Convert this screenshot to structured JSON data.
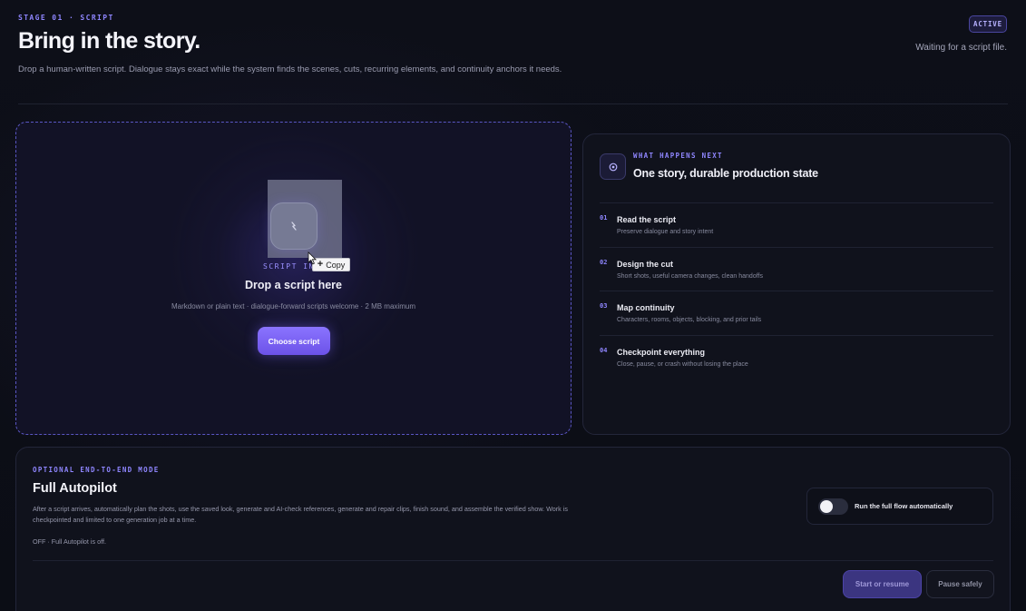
{
  "header": {
    "eyebrow": "STAGE 01 · SCRIPT",
    "title": "Bring in the story.",
    "subtitle": "Drop a human-written script. Dialogue stays exact while the system finds the scenes, cuts, recurring elements, and continuity anchors it needs.",
    "badge": "ACTIVE",
    "status": "Waiting for a script file."
  },
  "dropzone": {
    "intake_label": "SCRIPT INT",
    "tooltip_label": "Copy",
    "title": "Drop a script here",
    "hint": "Markdown or plain text · dialogue-forward scripts welcome · 2 MB maximum",
    "button_label": "Choose script"
  },
  "info": {
    "eyebrow": "WHAT HAPPENS NEXT",
    "title": "One story, durable production state",
    "steps": [
      {
        "num": "01",
        "title": "Read the script",
        "desc": "Preserve dialogue and story intent"
      },
      {
        "num": "02",
        "title": "Design the cut",
        "desc": "Short shots, useful camera changes, clean handoffs"
      },
      {
        "num": "03",
        "title": "Map continuity",
        "desc": "Characters, rooms, objects, blocking, and prior tails"
      },
      {
        "num": "04",
        "title": "Checkpoint everything",
        "desc": "Close, pause, or crash without losing the place"
      }
    ]
  },
  "autopilot": {
    "eyebrow": "OPTIONAL END-TO-END MODE",
    "title": "Full Autopilot",
    "description": "After a script arrives, automatically plan the shots, use the saved look, generate and AI-check references, generate and repair clips, finish sound, and assemble the verified show. Work is checkpointed and limited to one generation job at a time.",
    "status": "OFF · Full Autopilot is off.",
    "toggle_label": "Run the full flow automatically",
    "toggle_on": false,
    "start_label": "Start or resume",
    "pause_label": "Pause safely"
  },
  "colors": {
    "accent": "#8f86ff",
    "button": "#7a62f4",
    "background": "#0c0e16"
  }
}
